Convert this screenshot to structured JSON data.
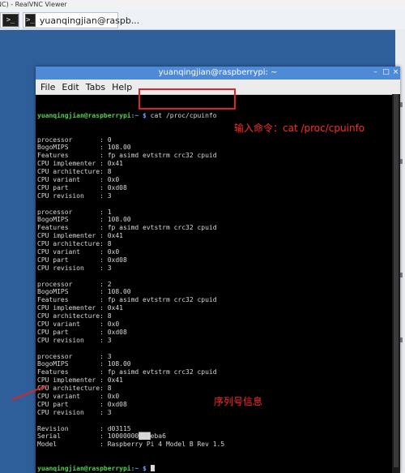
{
  "window": {
    "vnc_title": "NC) - RealVNC Viewer"
  },
  "taskbar": {
    "items": [
      {
        "label": "",
        "icon": "terminal-icon",
        "glyph": ">_"
      },
      {
        "label": "yuanqingjian@raspb...",
        "icon": "terminal-icon",
        "glyph": ">_"
      }
    ]
  },
  "terminal": {
    "title": "yuanqingjian@raspberrypi: ~",
    "controls": {
      "minimize": "–",
      "maximize": "□",
      "close": "×"
    },
    "menu": [
      "File",
      "Edit",
      "Tabs",
      "Help"
    ],
    "prompt_user": "yuanqingjian@raspberrypi",
    "prompt_path": ":~ $",
    "command": " cat /proc/cpuinfo",
    "lines": [
      "processor       : 0",
      "BogoMIPS        : 108.00",
      "Features        : fp asimd evtstrm crc32 cpuid",
      "CPU implementer : 0x41",
      "CPU architecture: 8",
      "CPU variant     : 0x0",
      "CPU part        : 0xd08",
      "CPU revision    : 3",
      "",
      "processor       : 1",
      "BogoMIPS        : 108.00",
      "Features        : fp asimd evtstrm crc32 cpuid",
      "CPU implementer : 0x41",
      "CPU architecture: 8",
      "CPU variant     : 0x0",
      "CPU part        : 0xd08",
      "CPU revision    : 3",
      "",
      "processor       : 2",
      "BogoMIPS        : 108.00",
      "Features        : fp asimd evtstrm crc32 cpuid",
      "CPU implementer : 0x41",
      "CPU architecture: 8",
      "CPU variant     : 0x0",
      "CPU part        : 0xd08",
      "CPU revision    : 3",
      "",
      "processor       : 3",
      "BogoMIPS        : 108.00",
      "Features        : fp asimd evtstrm crc32 cpuid",
      "CPU implementer : 0x41",
      "CPU architecture: 8",
      "CPU variant     : 0x0",
      "CPU part        : 0xd08",
      "CPU revision    : 3",
      "",
      "Revision        : d03115",
      "Serial          : 10000000███eba6",
      "Model           : Raspberry Pi 4 Model B Rev 1.5"
    ],
    "final_prompt_path": ":~ $ "
  },
  "annotations": {
    "command_note": "输入命令：cat /proc/cpuinfo",
    "serial_note": "序列号信息",
    "color": "#ff2b2b"
  }
}
